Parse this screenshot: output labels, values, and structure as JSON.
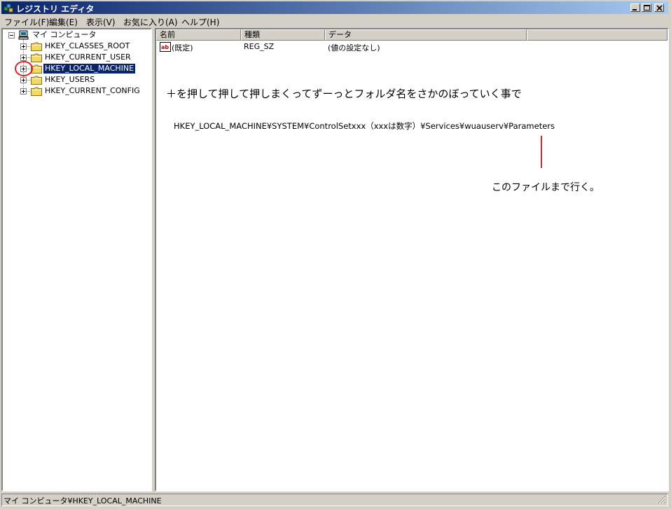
{
  "window": {
    "title": "レジストリ エディタ",
    "buttons": {
      "minimize_icon": "minimize-icon",
      "maximize_icon": "maximize-icon",
      "close_icon": "close-icon"
    }
  },
  "menu": [
    {
      "label": "ファイル(F)"
    },
    {
      "label": "編集(E)"
    },
    {
      "label": "表示(V)"
    },
    {
      "label": "お気に入り(A)"
    },
    {
      "label": "ヘルプ(H)"
    }
  ],
  "tree": {
    "root": {
      "label": "マイ コンピュータ",
      "icon": "computer-icon"
    },
    "keys": [
      {
        "label": "HKEY_CLASSES_ROOT",
        "icon": "folder-icon"
      },
      {
        "label": "HKEY_CURRENT_USER",
        "icon": "folder-icon"
      },
      {
        "label": "HKEY_LOCAL_MACHINE",
        "icon": "folder-icon",
        "selected": true
      },
      {
        "label": "HKEY_USERS",
        "icon": "folder-icon"
      },
      {
        "label": "HKEY_CURRENT_CONFIG",
        "icon": "folder-icon"
      }
    ]
  },
  "list": {
    "columns": [
      "名前",
      "種類",
      "データ"
    ],
    "rows": [
      {
        "name": "(既定)",
        "type": "REG_SZ",
        "data": "(値の設定なし)",
        "icon": "string-value-icon"
      }
    ]
  },
  "annotations": {
    "instruction": "＋を押して押して押しまくってずーっとフォルダ名をさかのぼっていく事で",
    "path": "HKEY_LOCAL_MACHINE¥SYSTEM¥ControlSetxxx（xxxは数字）¥Services¥wuauserv¥Parameters",
    "destination": "このファイルまで行く。",
    "highlight_color": "#e02020"
  },
  "status": {
    "text": "マイ コンピュータ¥HKEY_LOCAL_MACHINE"
  },
  "colors": {
    "titlebar_start": "#0a246a",
    "titlebar_end": "#a6caf0",
    "selection": "#0a246a",
    "face": "#d4d0c8"
  }
}
